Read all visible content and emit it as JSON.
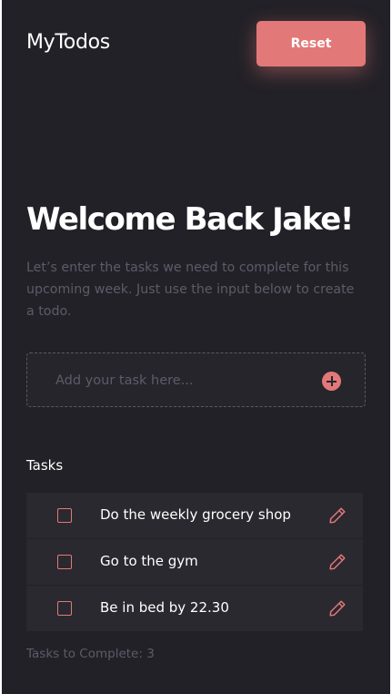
{
  "app": {
    "title": "MyTodos",
    "reset_label": "Reset"
  },
  "colors": {
    "background": "#222127",
    "accent": "#e37878",
    "muted_text": "#5d5b68",
    "row_background": "#2a2930"
  },
  "hero": {
    "heading": "Welcome Back Jake!",
    "intro": "Let’s enter the tasks we need to complete for this upcoming week. Just use the input below to create a todo."
  },
  "input": {
    "placeholder": "Add your task here...",
    "value": "",
    "add_icon": "plus-circle-icon"
  },
  "tasks": {
    "heading": "Tasks",
    "items": [
      {
        "label": "Do the weekly grocery shop",
        "completed": false,
        "edit_icon": "pencil-icon"
      },
      {
        "label": "Go to the gym",
        "completed": false,
        "edit_icon": "pencil-icon"
      },
      {
        "label": "Be in bed by 22.30",
        "completed": false,
        "edit_icon": "pencil-icon"
      }
    ],
    "count_text": "Tasks to Complete: 3"
  }
}
